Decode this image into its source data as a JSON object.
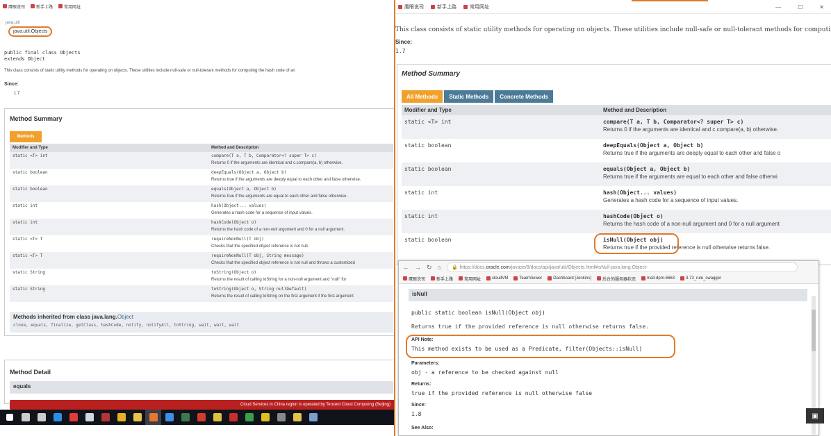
{
  "left": {
    "bookmarks": [
      {
        "icon": "bookmark-icon",
        "label": "鹰眼说司"
      },
      {
        "icon": "bookmark-icon",
        "label": "新手上路"
      },
      {
        "icon": "bookmark-icon",
        "label": "常用网址"
      }
    ],
    "package_label": "java.util",
    "class_name": "java.util.Objects",
    "declaration_1": "public final class Objects",
    "declaration_2": "extends Object",
    "description": "This class consists of static utility methods for operating on objects. These utilities include null-safe or null-tolerant methods for computing the hash code of an",
    "since_label": "Since:",
    "since_value": "1.7",
    "summary_title": "Method Summary",
    "tab_label": "Methods",
    "col_modifier": "Modifier and Type",
    "col_method": "Method and Description",
    "rows": [
      {
        "mod": "static <T> int",
        "sig": "compare(T a, T b, Comparator<? super T> c)",
        "desc": "Returns 0 if the arguments are identical and c.compare(a, b) otherwise."
      },
      {
        "mod": "static boolean",
        "sig": "deepEquals(Object a, Object b)",
        "desc": "Returns true if the arguments are deeply equal to each other and false otherwise."
      },
      {
        "mod": "static boolean",
        "sig": "equals(Object a, Object b)",
        "desc": "Returns true if the arguments are equal to each other and false otherwise."
      },
      {
        "mod": "static int",
        "sig": "hash(Object... values)",
        "desc": "Generates a hash code for a sequence of input values."
      },
      {
        "mod": "static int",
        "sig": "hashCode(Object o)",
        "desc": "Returns the hash code of a non-null argument and 0 for a null argument."
      },
      {
        "mod": "static <T> T",
        "sig": "requireNonNull(T obj)",
        "desc": "Checks that the specified object reference is not null."
      },
      {
        "mod": "static <T> T",
        "sig": "requireNonNull(T obj, String message)",
        "desc": "Checks that the specified object reference is not null and throws a customized"
      },
      {
        "mod": "static String",
        "sig": "toString(Object o)",
        "desc": "Returns the result of calling toString for a non-null argument and \"null\" for"
      },
      {
        "mod": "static String",
        "sig": "toString(Object o, String nullDefault)",
        "desc": "Returns the result of calling toString on the first argument if the first argument"
      }
    ],
    "inherited_title": "Methods inherited from class java.lang.",
    "inherited_link": "Object",
    "inherited_methods": "clone, equals, finalize, getClass, hashCode, notify, notifyAll, toString, wait, wait, wait",
    "detail_title": "Method Detail",
    "detail_head": "equals",
    "notice": "Cloud Services in China region is operated by Tencent Cloud Computing (Beijing)"
  },
  "taskbar": {
    "icons": [
      {
        "name": "start-icon",
        "color": "#ffffff"
      },
      {
        "name": "search-icon",
        "color": "#cccccc"
      },
      {
        "name": "task-view-icon",
        "color": "#cccccc"
      },
      {
        "name": "edge-icon",
        "color": "#2b8ee8"
      },
      {
        "name": "app-red-icon",
        "color": "#e33a3a"
      },
      {
        "name": "app-network-icon",
        "color": "#cfd8e0"
      },
      {
        "name": "app-media-icon",
        "color": "#b53434"
      },
      {
        "name": "chrome-icon",
        "color": "#e6b029"
      },
      {
        "name": "explorer-icon",
        "color": "#e8c24a"
      },
      {
        "name": "firefox-icon",
        "color": "#e8772a"
      },
      {
        "name": "notes-icon",
        "color": "#3c8ee6"
      },
      {
        "name": "terminal-icon",
        "color": "#3b7a4a"
      },
      {
        "name": "pdf-icon",
        "color": "#d23b2e"
      },
      {
        "name": "app-chat-icon",
        "color": "#e0c040"
      },
      {
        "name": "app-ruby-icon",
        "color": "#c92d2d"
      },
      {
        "name": "app-green-icon",
        "color": "#3aa04a"
      },
      {
        "name": "app-yellow-icon",
        "color": "#e0c020"
      },
      {
        "name": "app-gray-icon",
        "color": "#888888"
      },
      {
        "name": "app-folder-icon",
        "color": "#e5c24a"
      },
      {
        "name": "app-photo-icon",
        "color": "#7aa0d0"
      }
    ]
  },
  "right": {
    "bookmarks": [
      {
        "icon": "bookmark-icon",
        "label": "鹰眼说司"
      },
      {
        "icon": "bookmark-icon",
        "label": "新手上路"
      },
      {
        "icon": "bookmark-icon",
        "label": "常用网址"
      }
    ],
    "description": "This class consists of static utility methods for operating on objects. These utilities include null-safe or null-tolerant methods for computing",
    "since_label": "Since:",
    "since_value": "1.7",
    "summary_title": "Method Summary",
    "tabs": [
      "All Methods",
      "Static Methods",
      "Concrete Methods"
    ],
    "col_modifier": "Modifier and Type",
    "col_method": "Method and Description",
    "rows": [
      {
        "mod": "static <T> int",
        "sig": "compare(T a, T b, Comparator<? super T> c)",
        "desc": "Returns 0 if the arguments are identical and c.compare(a, b) otherwise."
      },
      {
        "mod": "static boolean",
        "sig": "deepEquals(Object a, Object b)",
        "desc": "Returns true if the arguments are deeply equal to each other and false o"
      },
      {
        "mod": "static boolean",
        "sig": "equals(Object a, Object b)",
        "desc": "Returns true if the arguments are equal to each other and false otherwi"
      },
      {
        "mod": "static int",
        "sig": "hash(Object... values)",
        "desc": "Generates a hash code for a sequence of input values."
      },
      {
        "mod": "static int",
        "sig": "hashCode(Object o)",
        "desc": "Returns the hash code of a non-null argument and 0 for a null argument"
      },
      {
        "mod": "static boolean",
        "sig": "isNull(Object obj)",
        "desc": "Returns true if the provided reference is null otherwise returns false."
      }
    ]
  },
  "popup": {
    "nav_back": "←",
    "nav_forward": "→",
    "nav_reload": "↻",
    "nav_home": "⌂",
    "url_secure": "🔒",
    "url_prefix": "https://docs.",
    "url_domain": "oracle.com",
    "url_rest": "/javase/8/docs/api/java/util/Objects.html#isNull-java.lang.Object-",
    "bookmarks": [
      "鹰眼说司",
      "新手上路",
      "常用网址",
      "cloudVM",
      "TeamViewer",
      "Dashboard [Jenkins]",
      "后台的服务器状态",
      "mall-dpm-6663",
      "3.73_rule_swagger"
    ],
    "method_head": "isNull",
    "signature": "public static boolean isNull(Object obj)",
    "returns_text": "Returns true if the provided reference is null otherwise returns false.",
    "api_note_label": "API Note:",
    "api_note_text": "This method exists to be used as a Predicate, filter(Objects::isNull)",
    "params_label": "Parameters:",
    "params_value": "obj - a reference to be checked against null",
    "returns_label": "Returns:",
    "returns_value": "true if the provided reference is null otherwise false",
    "since_label": "Since:",
    "since_value": "1.8",
    "see_also_label": "See Also:"
  },
  "notify_icon": "notification-icon"
}
